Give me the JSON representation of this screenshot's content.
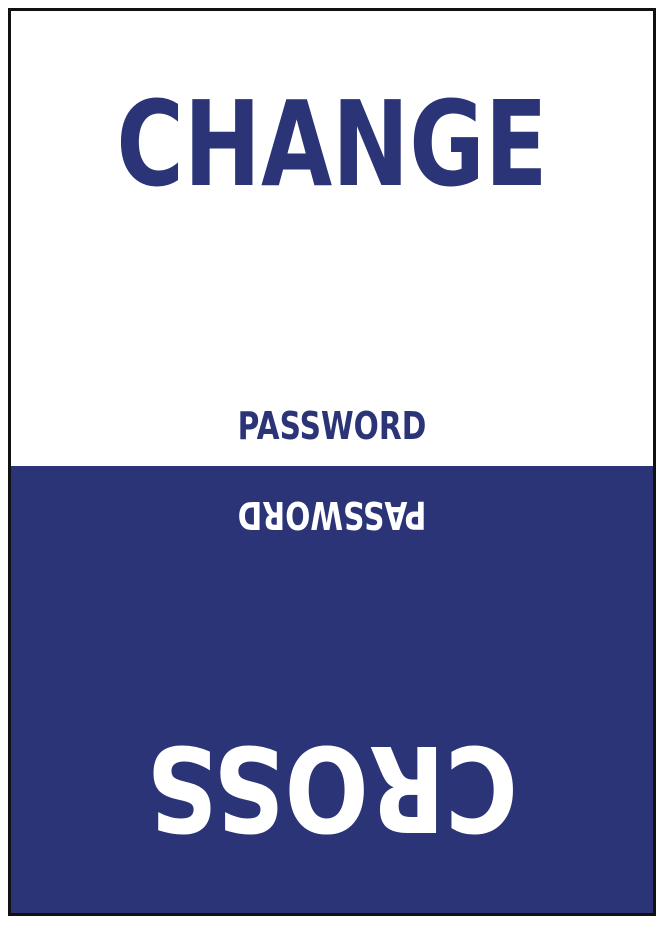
{
  "top_section": {
    "main_word": "CHANGE",
    "sub_word": "PASSWORD"
  },
  "bottom_section": {
    "sub_word": "PASSWORD",
    "main_word": "CROSS"
  },
  "colors": {
    "brand_blue": "#2b3476",
    "white": "#ffffff",
    "border": "#111111"
  }
}
